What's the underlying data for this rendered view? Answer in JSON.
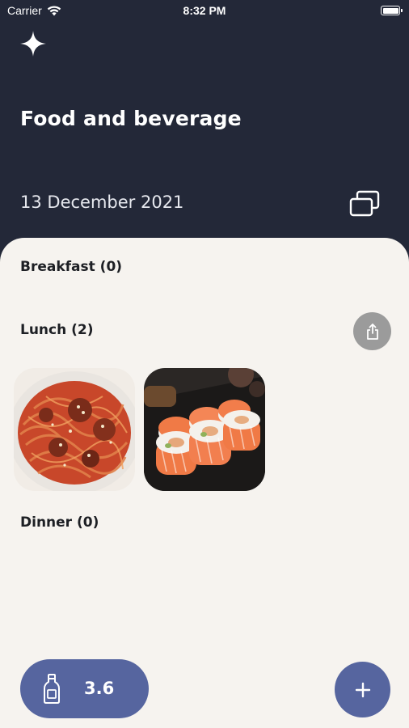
{
  "status_bar": {
    "carrier": "Carrier",
    "time": "8:32 PM"
  },
  "header": {
    "title": "Food and beverage",
    "date": "13 December 2021"
  },
  "meals": {
    "breakfast": "Breakfast (0)",
    "lunch": "Lunch (2)",
    "dinner": "Dinner (0)"
  },
  "drink": {
    "value": "3.6"
  },
  "colors": {
    "header_bg": "#232838",
    "sheet_bg": "#f6f3ef",
    "accent": "#56659f",
    "share_gray": "#9b9b9b"
  },
  "icons": {
    "sparkle": "sparkle-icon",
    "gallery": "gallery-icon",
    "share": "share-icon",
    "bottle": "bottle-icon",
    "add": "plus-icon"
  }
}
